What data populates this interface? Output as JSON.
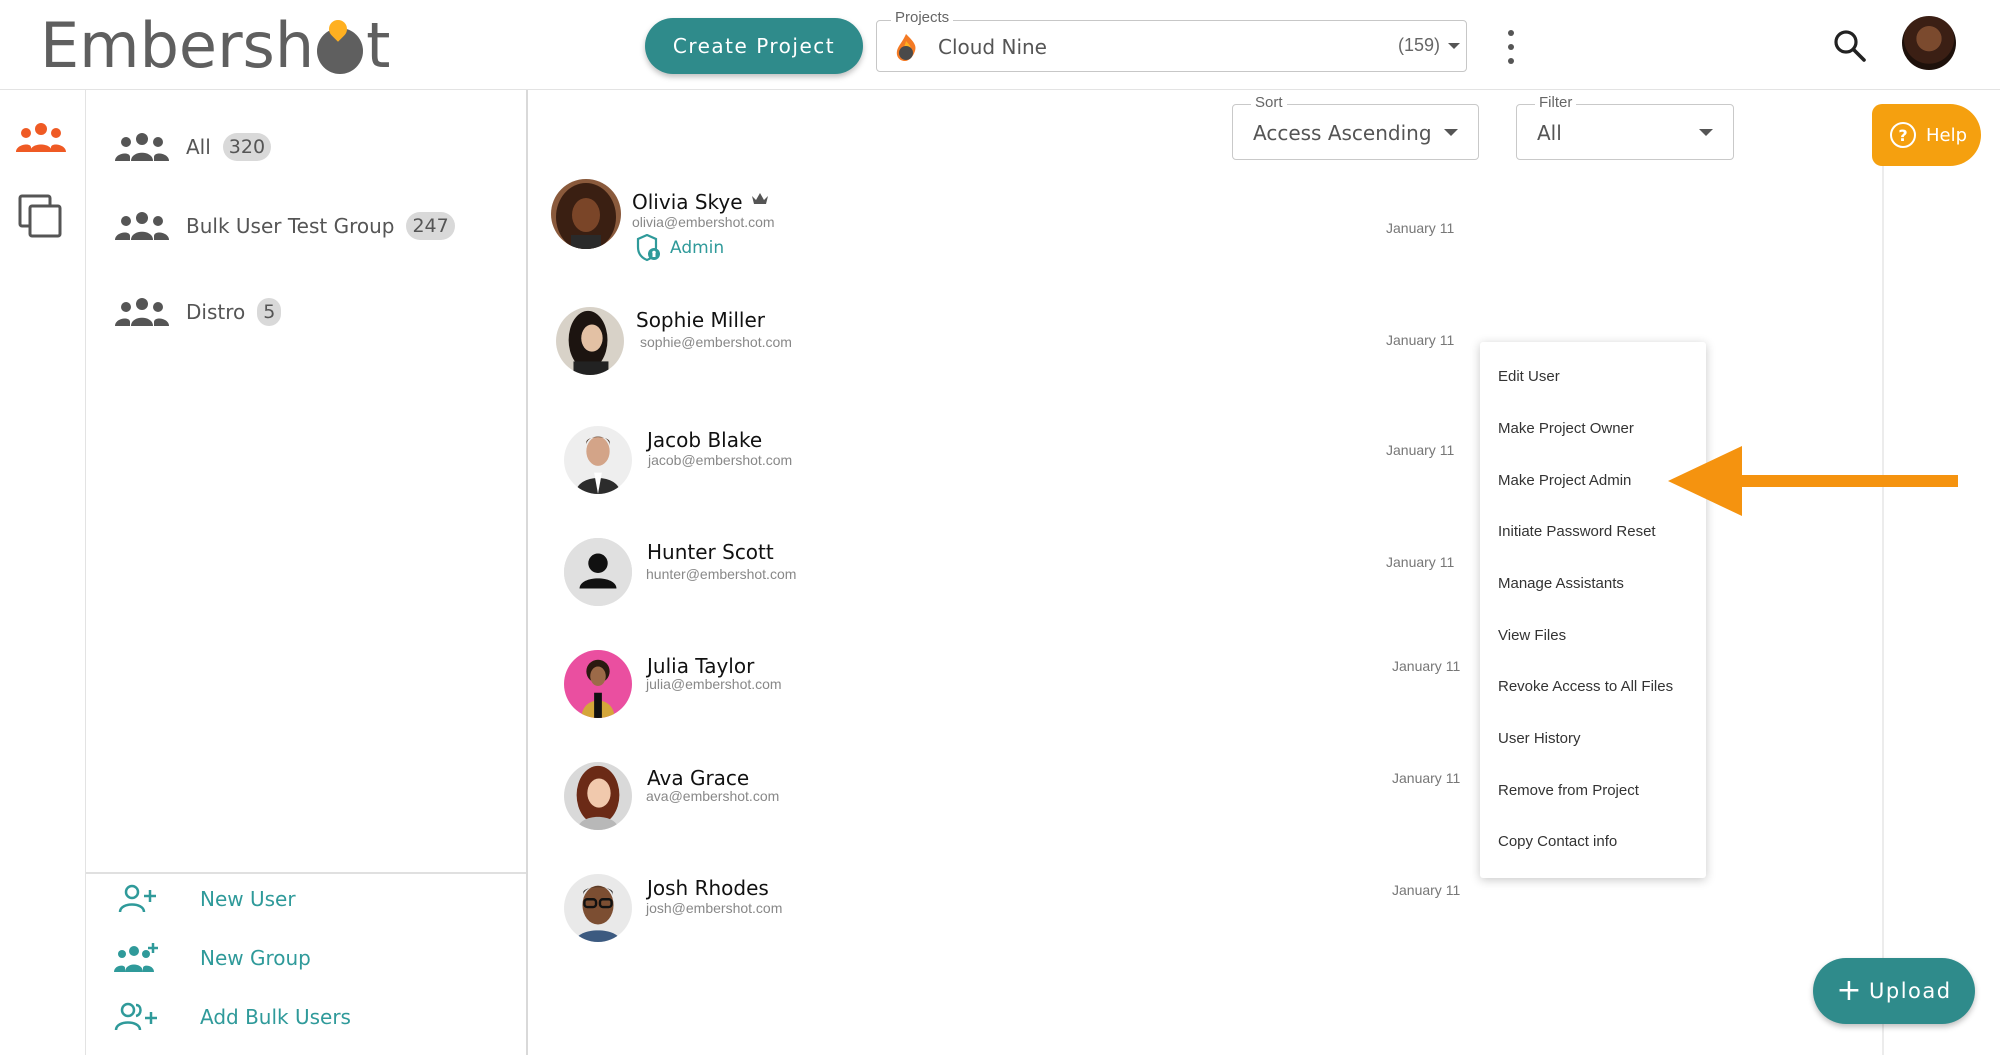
{
  "header": {
    "brand": "Embershot",
    "create_project_label": "Create Project",
    "projects": {
      "label": "Projects",
      "selected_name": "Cloud Nine",
      "count": "(159)"
    }
  },
  "groups": {
    "items": [
      {
        "label": "All",
        "count": "320"
      },
      {
        "label": "Bulk User Test Group",
        "count": "247"
      },
      {
        "label": "Distro",
        "count": "5"
      }
    ],
    "actions": [
      {
        "label": "New User"
      },
      {
        "label": "New Group"
      },
      {
        "label": "Add Bulk Users"
      }
    ]
  },
  "controls": {
    "sort": {
      "label": "Sort",
      "value": "Access Ascending"
    },
    "filter": {
      "label": "Filter",
      "value": "All"
    },
    "help_label": "Help",
    "upload_label": "Upload"
  },
  "users": [
    {
      "name": "Olivia Skye",
      "email": "olivia@embershot.com",
      "date": "January 11",
      "role": "Admin",
      "owner": true
    },
    {
      "name": "Sophie Miller",
      "email": "sophie@embershot.com",
      "date": "January 11"
    },
    {
      "name": "Jacob Blake",
      "email": "jacob@embershot.com",
      "date": "January 11"
    },
    {
      "name": "Hunter Scott",
      "email": "hunter@embershot.com",
      "date": "January 11"
    },
    {
      "name": "Julia Taylor",
      "email": "julia@embershot.com",
      "date": "January 11"
    },
    {
      "name": "Ava Grace",
      "email": "ava@embershot.com",
      "date": "January 11"
    },
    {
      "name": "Josh Rhodes",
      "email": "josh@embershot.com",
      "date": "January 11"
    }
  ],
  "context_menu": {
    "items": [
      "Edit User",
      "Make Project Owner",
      "Make Project Admin",
      "Initiate Password Reset",
      "Manage Assistants",
      "View Files",
      "Revoke Access to All Files",
      "User History",
      "Remove from Project",
      "Copy Contact info"
    ]
  },
  "colors": {
    "teal": "#2f8b8b",
    "teal_text": "#2f9a9a",
    "orange_accent": "#f5930f",
    "help_orange": "#f5a00f",
    "rail_active": "#ef5a24"
  },
  "icons": {
    "rail": [
      "users-icon",
      "copy-icon"
    ],
    "header": [
      "search-icon",
      "more-vert-icon"
    ]
  }
}
